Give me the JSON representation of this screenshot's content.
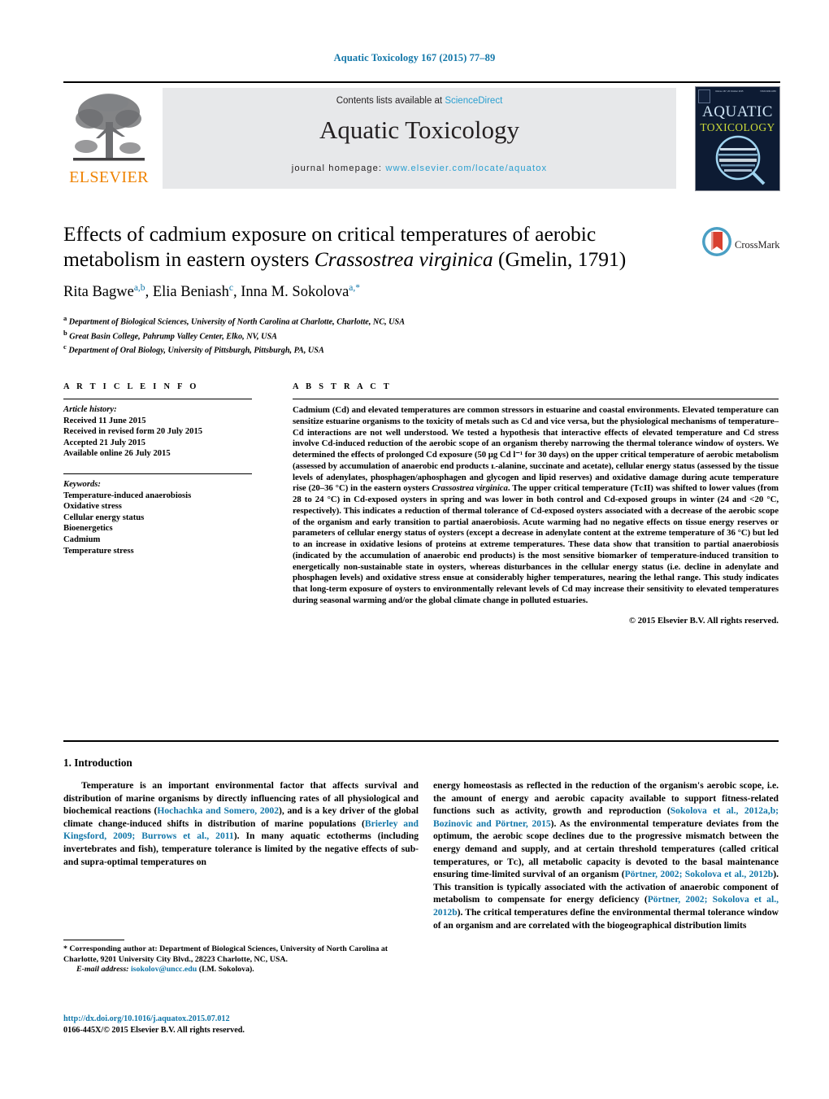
{
  "running_head": "Aquatic Toxicology 167 (2015) 77–89",
  "masthead": {
    "contents_prefix": "Contents lists available at ",
    "sciencedirect": "ScienceDirect",
    "journal_name": "Aquatic Toxicology",
    "homepage_label": "journal homepage:",
    "homepage_url": "www.elsevier.com/locate/aquatox",
    "publisher_logo_text": "ELSEVIER",
    "publisher_logo_icon": "elsevier-tree-icon",
    "cover": {
      "line1": "AQUATIC",
      "line2": "TOXICOLOGY",
      "micro_left": "Volume 167, 20 October 2015",
      "micro_right": "ISSN 0166-445X",
      "bg_color": "#0d1b33",
      "title_color": "#cfe4f5",
      "subtitle_color": "#cbd93a"
    },
    "accent_link_color": "#2a9fd0",
    "band_color": "#e7e8ea"
  },
  "crossmark": {
    "label": "CrossMark",
    "icon": "crossmark-icon",
    "ring_color": "#4a9fc4",
    "mark_color": "#d8402f"
  },
  "article": {
    "title_part1": "Effects of cadmium exposure on critical temperatures of aerobic metabolism in eastern oysters ",
    "title_italic": "Crassostrea virginica",
    "title_part2": " (Gmelin, 1791)",
    "authors_plain": "Rita Bagwe",
    "authors_html": "Rita Bagwe a,b, Elia Beniash c, Inna M. Sokolova a,*",
    "affiliations": [
      {
        "marker": "a",
        "text": "Department of Biological Sciences, University of North Carolina at Charlotte, Charlotte, NC, USA"
      },
      {
        "marker": "b",
        "text": "Great Basin College, Pahrump Valley Center, Elko, NV, USA"
      },
      {
        "marker": "c",
        "text": "Department of Oral Biology, University of Pittsburgh, Pittsburgh, PA, USA"
      }
    ]
  },
  "article_info": {
    "heading": "A R T I C L E   I N F O",
    "history_label": "Article history:",
    "history": [
      "Received 11 June 2015",
      "Received in revised form 20 July 2015",
      "Accepted 21 July 2015",
      "Available online 26 July 2015"
    ],
    "keywords_label": "Keywords:",
    "keywords": [
      "Temperature-induced anaerobiosis",
      "Oxidative stress",
      "Cellular energy status",
      "Bioenergetics",
      "Cadmium",
      "Temperature stress"
    ]
  },
  "abstract": {
    "heading": "A B S T R A C T",
    "text_before_species": "Cadmium (Cd) and elevated temperatures are common stressors in estuarine and coastal environments. Elevated temperature can sensitize estuarine organisms to the toxicity of metals such as Cd and vice versa, but the physiological mechanisms of temperature–Cd interactions are not well understood. We tested a hypothesis that interactive effects of elevated temperature and Cd stress involve Cd-induced reduction of the aerobic scope of an organism thereby narrowing the thermal tolerance window of oysters. We determined the effects of prolonged Cd exposure (50 μg Cd l⁻¹ for 30 days) on the upper critical temperature of aerobic metabolism (assessed by accumulation of anaerobic end products ʟ-alanine, succinate and acetate), cellular energy status (assessed by the tissue levels of adenylates, phosphagen/aphosphagen and glycogen and lipid reserves) and oxidative damage during acute temperature rise (20–36 °C) in the eastern oysters ",
    "species_italic": "Crassostrea virginica",
    "text_after_species": ". The upper critical temperature (TᴄII) was shifted to lower values (from 28 to 24 °C) in Cd-exposed oysters in spring and was lower in both control and Cd-exposed groups in winter (24 and <20 °C, respectively). This indicates a reduction of thermal tolerance of Cd-exposed oysters associated with a decrease of the aerobic scope of the organism and early transition to partial anaerobiosis. Acute warming had no negative effects on tissue energy reserves or parameters of cellular energy status of oysters (except a decrease in adenylate content at the extreme temperature of 36 °C) but led to an increase in oxidative lesions of proteins at extreme temperatures. These data show that transition to partial anaerobiosis (indicated by the accumulation of anaerobic end products) is the most sensitive biomarker of temperature-induced transition to energetically non-sustainable state in oysters, whereas disturbances in the cellular energy status (i.e. decline in adenylate and phosphagen levels) and oxidative stress ensue at considerably higher temperatures, nearing the lethal range. This study indicates that long-term exposure of oysters to environmentally relevant levels of Cd may increase their sensitivity to elevated temperatures during seasonal warming and/or the global climate change in polluted estuaries.",
    "copyright": "© 2015 Elsevier B.V. All rights reserved."
  },
  "body": {
    "section_heading": "1.  Introduction",
    "left_column": {
      "seg1": "Temperature is an important environmental factor that affects survival and distribution of marine organisms by directly influencing rates of all physiological and biochemical reactions (",
      "ref1": "Hochachka and Somero, 2002",
      "seg2": "), and is a key driver of the global climate change-induced shifts in distribution of marine populations (",
      "ref2": "Brierley and Kingsford, 2009; Burrows et al., 2011",
      "seg3": "). In many aquatic ectotherms (including invertebrates and fish), temperature tolerance is limited by the negative effects of sub- and supra-optimal temperatures on"
    },
    "right_column": {
      "seg1": "energy homeostasis as reflected in the reduction of the organism's aerobic scope, i.e. the amount of energy and aerobic capacity available to support fitness-related functions such as activity, growth and reproduction (",
      "ref1": "Sokolova et al., 2012a,b; Bozinovic and Pörtner, 2015",
      "seg2": "). As the environmental temperature deviates from the optimum, the aerobic scope declines due to the progressive mismatch between the energy demand and supply, and at certain threshold temperatures (called critical temperatures, or Tᴄ), all metabolic capacity is devoted to the basal maintenance ensuring time-limited survival of an organism (",
      "ref2": "Pörtner, 2002; Sokolova et al., 2012b",
      "seg3": "). This transition is typically associated with the activation of anaerobic component of metabolism to compensate for energy deficiency (",
      "ref3": "Pörtner, 2002; Sokolova et al., 2012b",
      "seg4": "). The critical temperatures define the environmental thermal tolerance window of an organism and are correlated with the biogeographical distribution limits"
    }
  },
  "footnote": {
    "star": "*",
    "corresponding": " Corresponding author at: Department of Biological Sciences, University of North Carolina at Charlotte, 9201 University City Blvd., 28223 Charlotte, NC, USA.",
    "email_label": "E-mail address:",
    "email": "isokolov@uncc.edu",
    "email_owner": "(I.M. Sokolova)."
  },
  "doi_block": {
    "doi": "http://dx.doi.org/10.1016/j.aquatox.2015.07.012",
    "issn_line": "0166-445X/© 2015 Elsevier B.V. All rights reserved."
  }
}
